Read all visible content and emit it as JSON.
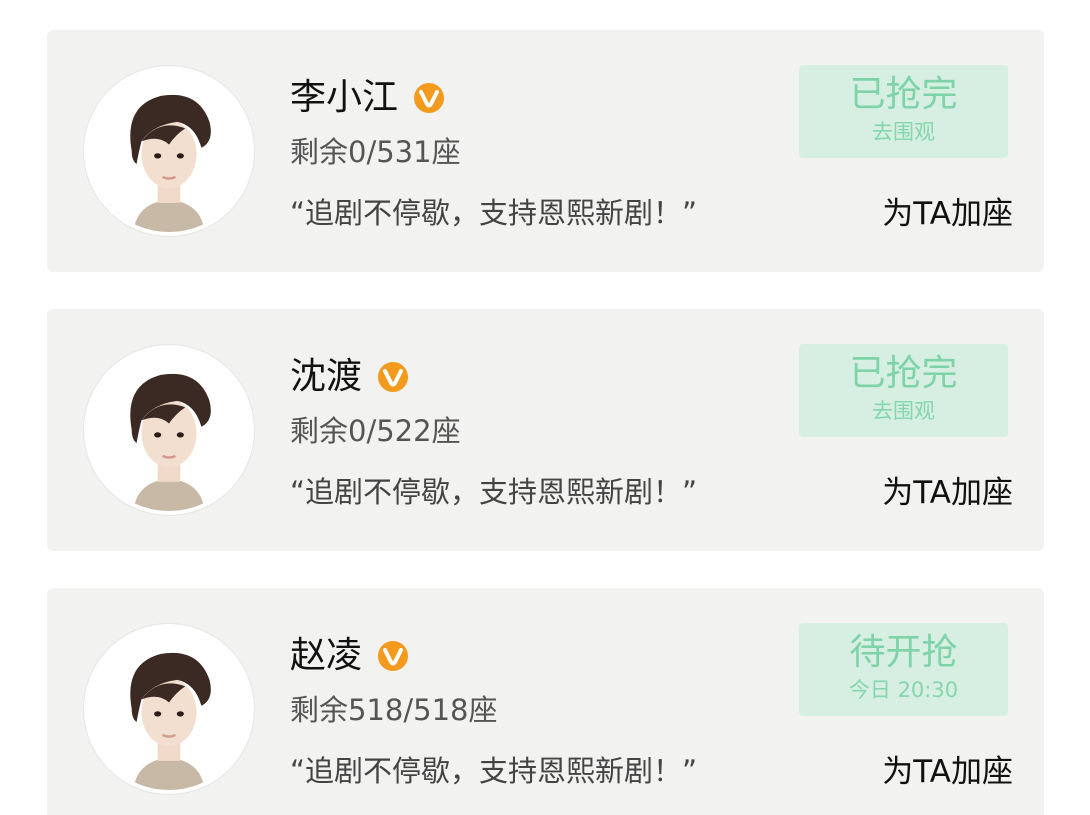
{
  "cards": [
    {
      "name": "李小江",
      "seats": "剩余0/531座",
      "quote": "“追剧不停歇，支持恩熙新剧！”",
      "status_main": "已抢完",
      "status_sub": "去围观",
      "action": "为TA加座"
    },
    {
      "name": "沈渡",
      "seats": "剩余0/522座",
      "quote": "“追剧不停歇，支持恩熙新剧！”",
      "status_main": "已抢完",
      "status_sub": "去围观",
      "action": "为TA加座"
    },
    {
      "name": "赵凌",
      "seats": "剩余518/518座",
      "quote": "“追剧不停歇，支持恩熙新剧！”",
      "status_main": "待开抢",
      "status_sub": "今日 20:30",
      "action": "为TA加座"
    }
  ],
  "icons": {
    "verified": "verified-v-badge-icon",
    "avatar": "avatar-portrait"
  },
  "colors": {
    "card_bg": "#f2f3f1",
    "status_bg": "#d6efe2",
    "status_text": "#7fd3a8",
    "badge_orange": "#f39a1f"
  }
}
